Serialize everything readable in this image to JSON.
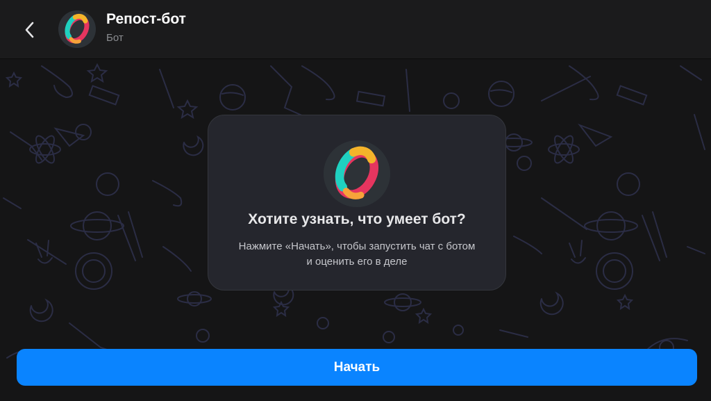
{
  "header": {
    "title": "Репост-бот",
    "subtitle": "Бот",
    "back_icon": "chevron-left-icon",
    "avatar_icon": "bot-ring-logo"
  },
  "info_card": {
    "title": "Хотите узнать, что умеет бот?",
    "description_line1": "Нажмите «Начать», чтобы запустить чат с ботом",
    "description_line2": "и оценить его в деле"
  },
  "start_button": {
    "label": "Начать"
  },
  "colors": {
    "accent": "#0a84ff",
    "header_bg": "#1b1b1c",
    "chat_bg": "#151516",
    "card_bg": "#25262d",
    "pattern": "#2b2d45"
  }
}
